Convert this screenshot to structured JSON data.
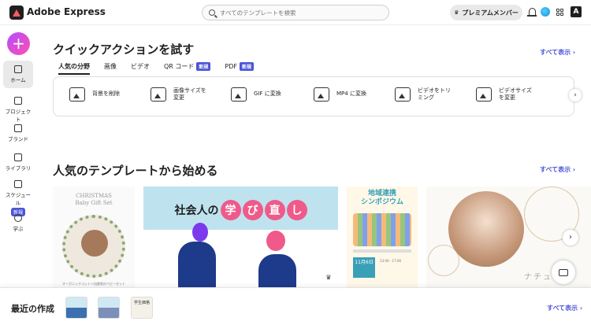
{
  "app": {
    "brand": "Adobe Express"
  },
  "search": {
    "placeholder": "すべてのテンプレートを検索"
  },
  "header": {
    "premium_label": "プレミアムメンバー",
    "adobe_letter": "A"
  },
  "sidebar": {
    "create": "+",
    "items": [
      {
        "label": "ホーム",
        "icon": "home-icon"
      },
      {
        "label": "プロジェクト",
        "icon": "folder-icon"
      },
      {
        "label": "ブランド",
        "icon": "brand-icon"
      },
      {
        "label": "ライブラリ",
        "icon": "library-icon"
      },
      {
        "label": "スケジュール",
        "icon": "calendar-icon",
        "badge": "新規"
      },
      {
        "label": "学ぶ",
        "icon": "lightbulb-icon"
      }
    ]
  },
  "quick_actions": {
    "title": "クイックアクションを試す",
    "see_all": "すべて表示",
    "tabs": [
      {
        "label": "人気の分野"
      },
      {
        "label": "画像"
      },
      {
        "label": "ビデオ"
      },
      {
        "label": "QR コード",
        "badge": "新規"
      },
      {
        "label": "PDF",
        "badge": "新規"
      }
    ],
    "actions": [
      {
        "label": "背景を削除",
        "icon": "image-icon"
      },
      {
        "label": "画像サイズを変更",
        "icon": "resize-image-icon"
      },
      {
        "label": "GIF に変換",
        "icon": "gif-icon"
      },
      {
        "label": "MP4 に変換",
        "icon": "mp4-icon"
      },
      {
        "label": "ビデオをトリミング",
        "icon": "trim-video-icon"
      },
      {
        "label": "ビデオサイズを変更",
        "icon": "resize-video-icon"
      }
    ]
  },
  "templates": {
    "title": "人気のテンプレートから始める",
    "see_all": "すべて表示",
    "cards": [
      {
        "line1": "CHRISTMAS",
        "line2": "Baby Gift Set",
        "caption": "オーガニックコットン出産祝のベビーセット"
      },
      {
        "text_prefix": "社会人の",
        "text_bubbles": [
          "学",
          "び",
          "直",
          "し"
        ]
      },
      {
        "title_line1": "地域連携",
        "title_line2": "シンポジウム",
        "date": "11月6日",
        "time": "13:00 - 17:00"
      },
      {
        "name": "ナチュ"
      }
    ]
  },
  "recent": {
    "title": "最近の作成",
    "see_all": "すべて表示",
    "thumb3_text": "学生価格"
  },
  "colors": {
    "accent": "#4b55d6",
    "create_gradient_start": "#b24dff",
    "create_gradient_end": "#ff4fb0",
    "badge": "#4b55d6"
  }
}
